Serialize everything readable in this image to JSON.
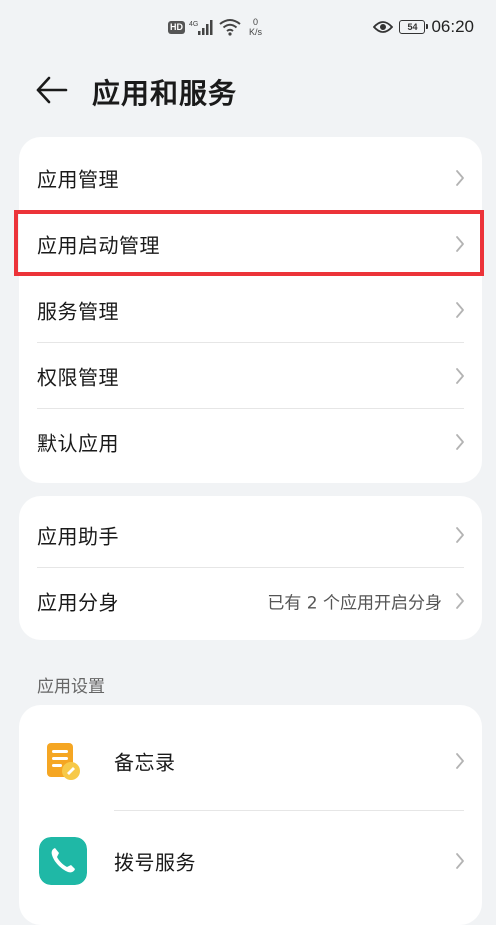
{
  "status_bar": {
    "hd": "HD",
    "signal_tag": "4G",
    "net_speed_value": "0",
    "net_speed_unit": "K/s",
    "battery": "54",
    "time": "06:20"
  },
  "header": {
    "title": "应用和服务"
  },
  "group1": {
    "items": [
      {
        "label": "应用管理"
      },
      {
        "label": "应用启动管理"
      },
      {
        "label": "服务管理"
      },
      {
        "label": "权限管理"
      },
      {
        "label": "默认应用"
      }
    ]
  },
  "group2": {
    "items": [
      {
        "label": "应用助手"
      },
      {
        "label": "应用分身",
        "value": "已有 2 个应用开启分身"
      }
    ]
  },
  "app_settings": {
    "header": "应用设置",
    "items": [
      {
        "label": "备忘录",
        "icon": "notepad-icon"
      },
      {
        "label": "拨号服务",
        "icon": "phone-icon"
      }
    ]
  },
  "colors": {
    "background": "#f1f3f5",
    "card": "#ffffff",
    "highlight": "#ec3339",
    "phone_icon": "#1fb8a6",
    "notepad_icon": "#f5a623"
  }
}
